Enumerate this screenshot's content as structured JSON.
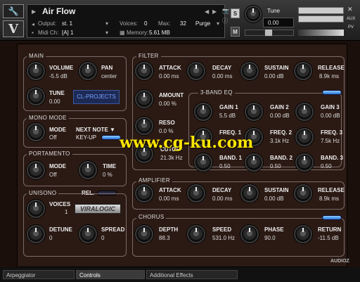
{
  "header": {
    "instrument_name": "Air Flow",
    "output_label": "Output:",
    "output_value": "st. 1",
    "voices_label": "Voices:",
    "voices_value": "0",
    "max_label": "Max:",
    "max_value": "32",
    "purge_label": "Purge",
    "midi_label": "Midi Ch:",
    "midi_value": "[A] 1",
    "memory_label": "Memory:",
    "memory_value": "5.61 MB",
    "s_label": "S",
    "m_label": "M",
    "tune_label": "Tune",
    "tune_value": "0.00",
    "aux_label": "AUX",
    "pv_label": "PV"
  },
  "main": {
    "title": "MAIN",
    "volume_label": "VOLUME",
    "volume_value": "-5.5 dB",
    "pan_label": "PAN",
    "pan_value": "center",
    "tune_label": "TUNE",
    "tune_value": "0.00",
    "logo_text": "CL-PROJECTS"
  },
  "mono": {
    "title": "MONO MODE",
    "mode_label": "MODE",
    "mode_value": "Off",
    "next_note_label": "NEXT NOTE ▼",
    "keyup_label": "KEY-UP"
  },
  "porta": {
    "title": "PORTAMENTO",
    "mode_label": "MODE",
    "mode_value": "Off",
    "time_label": "TIME",
    "time_value": "0 %",
    "rel_label": "REL."
  },
  "unison": {
    "title": "UNISONO",
    "voices_label": "VOICES",
    "voices_value": "1",
    "detune_label": "DETUNE",
    "detune_value": "0",
    "spread_label": "SPREAD",
    "spread_value": "0",
    "brand": "VIRALOGIC"
  },
  "filter": {
    "title": "FILTER",
    "attack_label": "ATTACK",
    "attack_value": "0.00 ms",
    "decay_label": "DECAY",
    "decay_value": "0.00 ms",
    "sustain_label": "SUSTAIN",
    "sustain_value": "0.00 dB",
    "release_label": "RELEASE",
    "release_value": "8.9k ms",
    "amount_label": "AMOUNT",
    "amount_value": "0.00 %",
    "reso_label": "RESO",
    "reso_value": "0.0 %",
    "cutoff_label": "CUTOFF",
    "cutoff_value": "21.3k Hz"
  },
  "eq": {
    "title": "3-BAND EQ",
    "gain1_label": "GAIN 1",
    "gain1_value": "5.5 dB",
    "gain2_label": "GAIN 2",
    "gain2_value": "0.00 dB",
    "gain3_label": "GAIN 3",
    "gain3_value": "0.00 dB",
    "freq1_label": "FREQ. 1",
    "freq1_value": "",
    "freq2_label": "FREQ. 2",
    "freq2_value": "3.1k Hz",
    "freq3_label": "FREQ. 3",
    "freq3_value": "7.5k Hz",
    "band1_label": "BAND. 1",
    "band1_value": "0.50",
    "band2_label": "BAND. 2",
    "band2_value": "0.50",
    "band3_label": "BAND. 3",
    "band3_value": "0.50"
  },
  "amp": {
    "title": "AMPLIFIER",
    "attack_label": "ATTACK",
    "attack_value": "0.00 ms",
    "decay_label": "DECAY",
    "decay_value": "0.00 ms",
    "sustain_label": "SUSTAIN",
    "sustain_value": "0.00 dB",
    "release_label": "RELEASE",
    "release_value": "8.9k ms"
  },
  "chorus": {
    "title": "CHORUS",
    "depth_label": "DEPTH",
    "depth_value": "88.3",
    "speed_label": "SPEED",
    "speed_value": "531.0 Hz",
    "phase_label": "PHASE",
    "phase_value": "90.0",
    "return_label": "RETURN",
    "return_value": "-11.5 dB"
  },
  "tabs": [
    "Arpeggiator",
    "Controls",
    "Additional Effects"
  ],
  "watermark": "www.cg-ku.com",
  "corner_mark": "AUDIOZ"
}
